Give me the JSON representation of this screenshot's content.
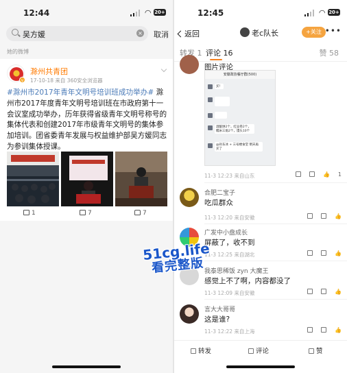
{
  "left": {
    "status": {
      "time": "12:44",
      "battery": "20+"
    },
    "search": {
      "value": "吴方媛",
      "cancel": "取消"
    },
    "section_label": "她的微博",
    "post": {
      "author": "滁州共青团",
      "meta": "17-10-18  来自 360安全浏览器",
      "tag": "#滁州市2017年青年文明号培训班成功举办#",
      "body": " 滁州市2017年度青年文明号培训班在市政府第十一会议室成功举办，历年获得省级青年文明号称号的集体代表和创建2017年市级青年文明号的集体参加培训。团省委青年发展与权益维护部吴方媛同志为参训集体授课。",
      "repost_count": "1",
      "comment_count": "7",
      "like_count": "7"
    }
  },
  "right": {
    "status": {
      "time": "12:45",
      "battery": "20+"
    },
    "topbar": {
      "back": "返回",
      "owner": "老c队长",
      "follow": "+关注",
      "more": "•••"
    },
    "tabs": {
      "repost": "转发 1",
      "comments": "评论 16",
      "likes": "赞 58"
    },
    "comments": [
      {
        "name": "",
        "text": "图片评论",
        "meta": "11-3 12:23  来自山东",
        "likes": "1",
        "chat": {
          "header": "安徽政协餐厅群(500)",
          "lines": [
            "买！",
            "酒酿饼2个，红豆卷2个，糯米三角2个，馒头10个",
            "@孙东冰 + 三号楼食堂 明天再买了"
          ]
        }
      },
      {
        "name": "合肥二宝子",
        "text": "吃瓜群众",
        "meta": "11-3 12:20  来自安徽",
        "likes": ""
      },
      {
        "name": "广发中小盘成长",
        "text": "屏蔽了，收不到",
        "meta": "11-3 12:25  来自湖北",
        "likes": ""
      },
      {
        "name": "我泰思稀饭 zyn 大魔王",
        "text": "感觉上不了啊，内容都没了",
        "meta": "11-3 12:09  来自安徽",
        "likes": ""
      },
      {
        "name": "言大大哥哥",
        "text": "这是谁?",
        "meta": "11-3 12:22  来自上海",
        "likes": ""
      }
    ],
    "bottom": {
      "repost": "转发",
      "comment": "评论",
      "like": "赞"
    }
  },
  "watermark": {
    "line1": "51cg.life",
    "line2": "看完整版"
  },
  "colors": {
    "accent": "#f58220",
    "tag_blue": "#4b7bb8",
    "author_orange": "#ff7a00",
    "watermark": "#1a56c9"
  }
}
